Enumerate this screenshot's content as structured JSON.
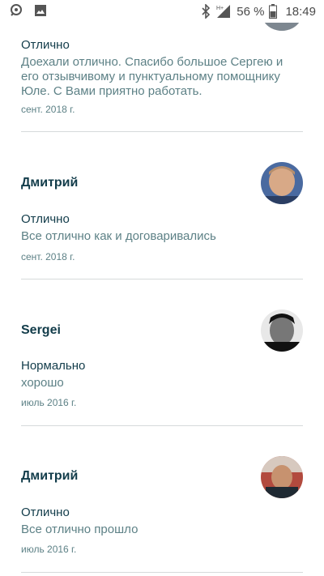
{
  "status_bar": {
    "battery": "56 %",
    "time": "18:49",
    "icons": [
      "chat-bubble-icon",
      "image-icon",
      "bluetooth-icon",
      "signal-icon",
      "battery-icon"
    ]
  },
  "colors": {
    "name": "#123c4a",
    "text_muted": "#5d8186",
    "divider": "#d6dadb"
  },
  "reviews": [
    {
      "rating": "Отлично",
      "text": "Доехали отлично. Спасибо большое Сергею и его отзывчивому и пунктуальному помощнику Юле. С Вами приятно работать.",
      "date": "сент. 2018 г."
    },
    {
      "name": "Дмитрий",
      "rating": "Отлично",
      "text": "Все отлично как и договаривались",
      "date": "сент. 2018 г."
    },
    {
      "name": "Sergei",
      "rating": "Нормально",
      "text": "хорошо",
      "date": "июль 2016 г."
    },
    {
      "name": "Дмитрий",
      "rating": "Отлично",
      "text": "Все отлично прошло",
      "date": "июль 2016 г."
    }
  ]
}
